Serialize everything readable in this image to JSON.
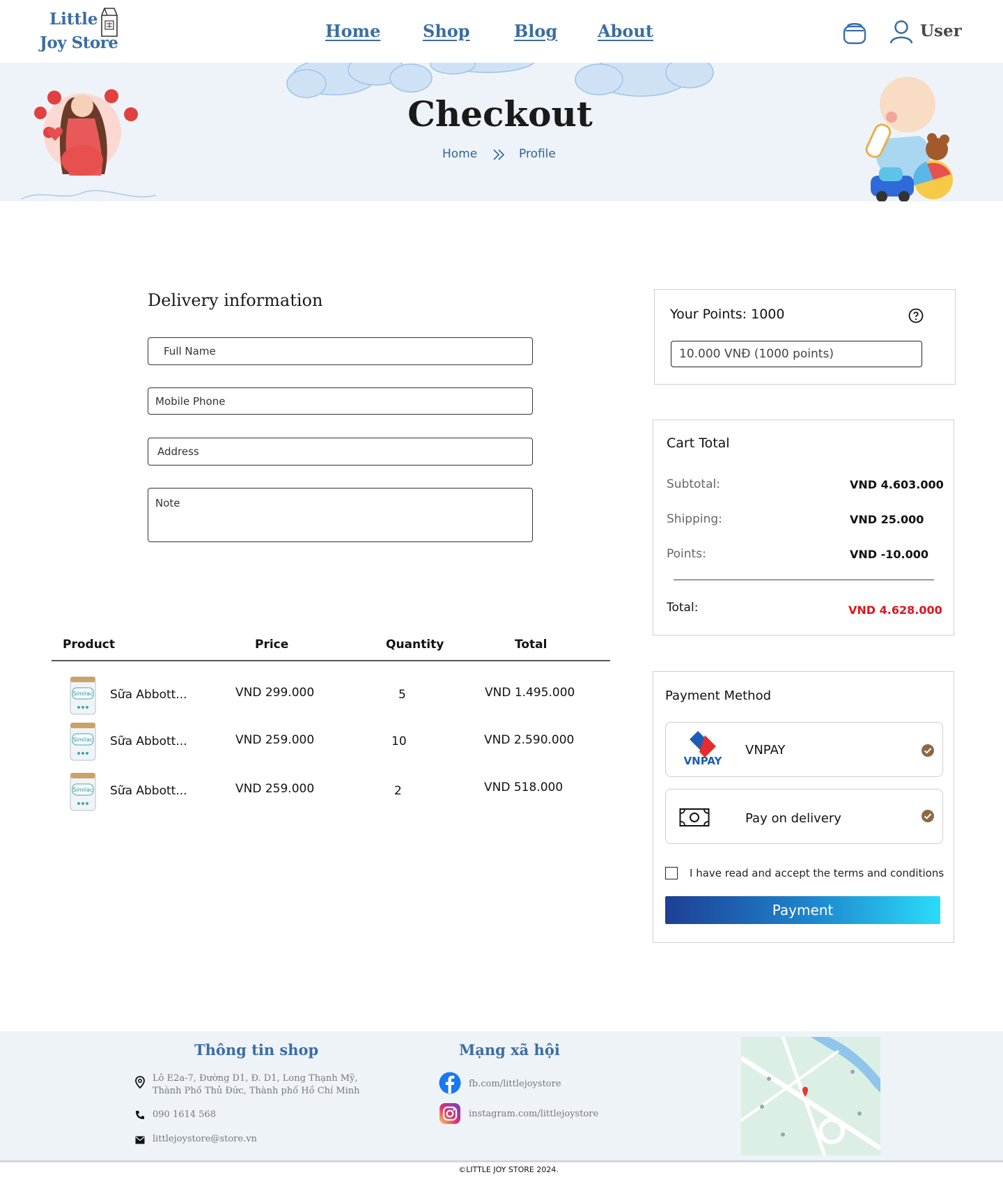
{
  "brand": {
    "line1": "Little",
    "line2": "Joy Store"
  },
  "nav": {
    "home": "Home",
    "shop": "Shop",
    "blog": "Blog",
    "about": "About",
    "user": "User"
  },
  "banner": {
    "title": "Checkout",
    "crumb_home": "Home",
    "crumb_current": "Profile"
  },
  "delivery": {
    "title": "Delivery information",
    "full_name_placeholder": "Full Name",
    "phone_placeholder": "Mobile Phone",
    "address_placeholder": "Address",
    "note_placeholder": "Note"
  },
  "table": {
    "headers": {
      "product": "Product",
      "price": "Price",
      "quantity": "Quantity",
      "total": "Total"
    },
    "rows": [
      {
        "name": "Sữa Abbott...",
        "price": "VND 299.000",
        "quantity": "5",
        "total": "VND 1.495.000"
      },
      {
        "name": "Sữa Abbott...",
        "price": "VND 259.000",
        "quantity": "10",
        "total": "VND 2.590.000"
      },
      {
        "name": "Sữa Abbott...",
        "price": "VND 259.000",
        "quantity": "2",
        "total": "VND 518.000"
      }
    ],
    "product_image_label": "Similac"
  },
  "points": {
    "title": "Your Points: 1000",
    "selected": "10.000 VNĐ (1000 points)"
  },
  "cart": {
    "title": "Cart Total",
    "subtotal_label": "Subtotal:",
    "subtotal": "VND 4.603.000",
    "shipping_label": "Shipping:",
    "shipping": "VND 25.000",
    "points_label": "Points:",
    "points": "VND -10.000",
    "total_label": "Total:",
    "total": "VND 4.628.000"
  },
  "payment": {
    "title": "Payment Method",
    "options": [
      {
        "label": "VNPAY",
        "logo": "VNPAY"
      },
      {
        "label": "Pay on delivery"
      }
    ],
    "terms": "I have read and accept the terms and conditions",
    "button": "Payment"
  },
  "footer": {
    "shop_title": "Thông tin shop",
    "address_line1": "Lô E2a-7, Đường D1, Đ. D1, Long Thạnh Mỹ,",
    "address_line2": "Thành Phố Thủ Đức, Thành phố Hồ Chí Minh",
    "phone": "090 1614 568",
    "email": "littlejoystore@store.vn",
    "social_title": "Mạng xã hội",
    "facebook": "fb.com/littlejoystore",
    "instagram": "instagram.com/littlejoystore",
    "copyright": "©LITTLE JOY STORE 2024."
  },
  "colors": {
    "brand_blue": "#3b6da3",
    "total_red": "#e2141b",
    "check_brown": "#8a6a45",
    "footer_bg": "#eef3f8"
  }
}
